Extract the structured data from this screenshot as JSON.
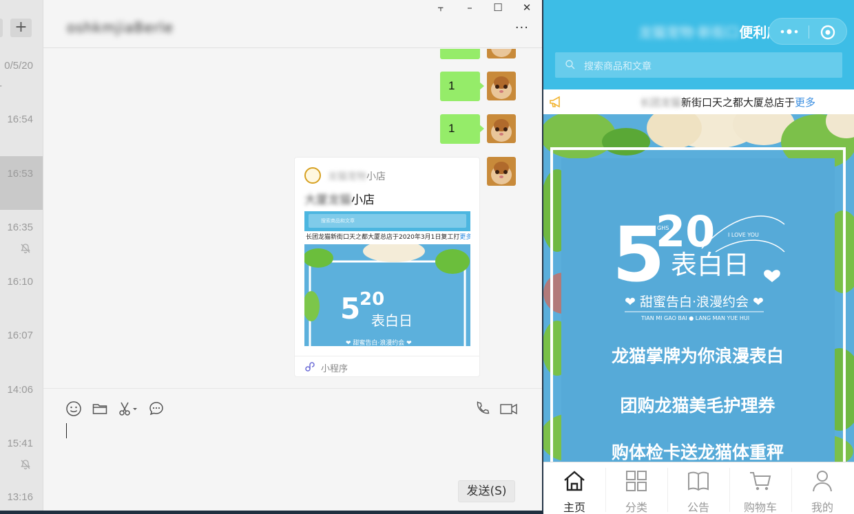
{
  "conversations": {
    "top_date": "0/5/20",
    "rows": [
      {
        "time": "16:54",
        "muted": false,
        "selected": false
      },
      {
        "time": "16:53",
        "muted": false,
        "selected": true
      },
      {
        "time": "16:35",
        "muted": true,
        "selected": false
      },
      {
        "time": "16:10",
        "muted": false,
        "selected": false
      },
      {
        "time": "16:07",
        "muted": false,
        "selected": false
      },
      {
        "time": "14:06",
        "muted": false,
        "selected": false
      },
      {
        "time": "15:41",
        "muted": true,
        "selected": false
      },
      {
        "time": "13:16",
        "muted": false,
        "selected": false
      }
    ],
    "add_label": "+"
  },
  "chat": {
    "title": "oshkmjiaBerle",
    "window_buttons": {
      "pin": "⫟",
      "minimize": "–",
      "maximize": "☐",
      "close": "✕"
    },
    "more": "···",
    "messages": [
      {
        "text": "1"
      },
      {
        "text": "1"
      }
    ],
    "mini_card": {
      "shop_blur": "龙猫宠物",
      "shop_suffix": "小店",
      "title_blur": "大厦龙猫",
      "title_suffix": "小店",
      "preview_search": "搜索商品和文章",
      "preview_notice": "长团龙猫新街口天之都大厦总店于2020年3月1日复工打",
      "preview_more": "更多",
      "footer_label": "小程序"
    },
    "send_label": "发送(S)"
  },
  "miniprogram": {
    "title_blur": "龙猫宠物·新街口",
    "title": "便利店",
    "search_placeholder": "搜索商品和文章",
    "notice_blur": "长团龙猫",
    "notice_text": "新街口天之都大厦总店于",
    "notice_more": "更多",
    "banner": {
      "big_number_5": "5",
      "big_number_20": "20",
      "ghs": "GHS",
      "love": "I LOVE YOU",
      "headline": "表白日",
      "subtitle": "❤ 甜蜜告白·浪漫约会 ❤",
      "pinyin": "TIAN MI GAO BAI ● LANG MAN YUE HUI",
      "line1": "龙猫掌牌为你浪漫表白",
      "line2": "团购龙猫美毛护理券",
      "line3": "购体检卡送龙猫体重秤"
    },
    "tabs": [
      {
        "label": "主页",
        "active": true
      },
      {
        "label": "分类",
        "active": false
      },
      {
        "label": "公告",
        "active": false
      },
      {
        "label": "购物车",
        "active": false
      },
      {
        "label": "我的",
        "active": false
      }
    ]
  }
}
